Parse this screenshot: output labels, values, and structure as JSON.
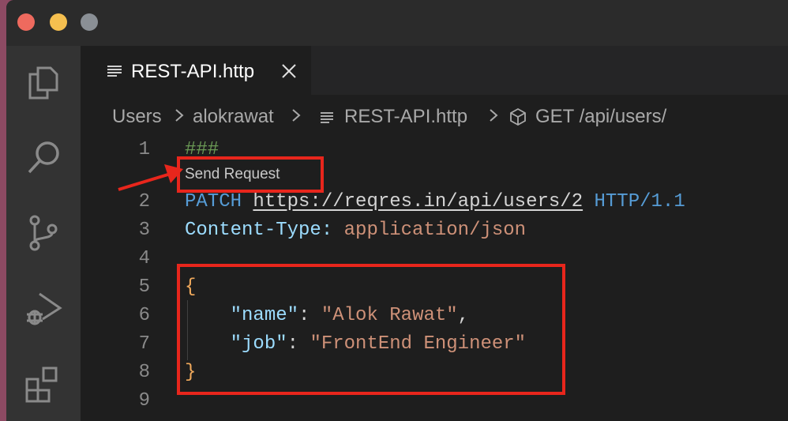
{
  "window": {
    "traffic_lights": [
      "close",
      "minimize",
      "zoom"
    ]
  },
  "activity_bar": {
    "icons": [
      "explorer-icon",
      "search-icon",
      "source-control-icon",
      "run-debug-icon",
      "extensions-icon"
    ]
  },
  "tab": {
    "label": "REST-API.http",
    "close_glyph": "×"
  },
  "breadcrumb": {
    "items": [
      "Users",
      "alokrawat",
      "REST-API.http",
      "GET /api/users/"
    ]
  },
  "code": {
    "codelens": "Send Request",
    "lines": [
      {
        "num": "1",
        "text": "###"
      },
      {
        "num": "2",
        "method": "PATCH",
        "url": "https://reqres.in/api/users/2",
        "version": "HTTP/1.1"
      },
      {
        "num": "3",
        "header_name": "Content-Type:",
        "header_value": "application/json"
      },
      {
        "num": "4",
        "text": ""
      },
      {
        "num": "5",
        "text": "{"
      },
      {
        "num": "6",
        "key": "\"name\"",
        "sep": ": ",
        "value": "\"Alok Rawat\"",
        "tail": ","
      },
      {
        "num": "7",
        "key": "\"job\"",
        "sep": ": ",
        "value": "\"FrontEnd Engineer\"",
        "tail": ""
      },
      {
        "num": "8",
        "text": "}"
      },
      {
        "num": "9",
        "text": ""
      }
    ]
  },
  "colors": {
    "annotation": "#e8261c",
    "string": "#ce9178",
    "keyword": "#569cd6",
    "brace": "#f0a95c"
  }
}
